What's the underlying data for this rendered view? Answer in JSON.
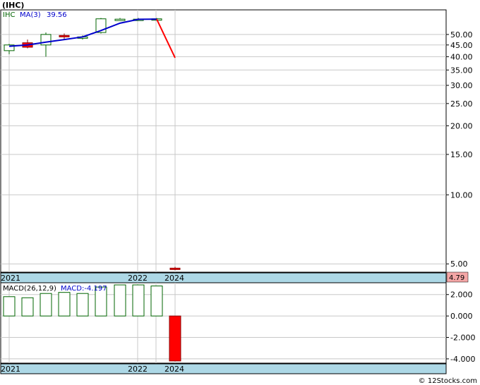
{
  "title": "(IHC)",
  "watermark": "© 12Stocks.com",
  "chart_data": [
    {
      "type": "candlestick",
      "ticker": "IHC",
      "legend": {
        "ticker": "IHC",
        "ma_label": "MA(3)",
        "ma_value": "39.56"
      },
      "y_scale": "log",
      "ylim": [
        4.6,
        64
      ],
      "y_ticks": [
        {
          "value": 50,
          "label": "50.00"
        },
        {
          "value": 45,
          "label": "45.00"
        },
        {
          "value": 40,
          "label": "40.00"
        },
        {
          "value": 35,
          "label": "35.00"
        },
        {
          "value": 30,
          "label": "30.00"
        },
        {
          "value": 25,
          "label": "25.00"
        },
        {
          "value": 20,
          "label": "20.00"
        },
        {
          "value": 15,
          "label": "15.00"
        },
        {
          "value": 10,
          "label": "10.00"
        },
        {
          "value": 5,
          "label": "5.00"
        }
      ],
      "x_labels": [
        "2021",
        "2022",
        "2024"
      ],
      "last_price_badge": "4.79",
      "candles": [
        {
          "open": 42.5,
          "high": 45.5,
          "low": 41.0,
          "close": 45.0
        },
        {
          "open": 46.0,
          "high": 47.5,
          "low": 43.5,
          "close": 44.0
        },
        {
          "open": 45.0,
          "high": 51.0,
          "low": 40.0,
          "close": 50.0
        },
        {
          "open": 49.5,
          "high": 50.5,
          "low": 47.5,
          "close": 49.0
        },
        {
          "open": 48.5,
          "high": 49.5,
          "low": 47.5,
          "close": 48.8
        },
        {
          "open": 51.0,
          "high": 59.0,
          "low": 50.5,
          "close": 58.5
        },
        {
          "open": 58.0,
          "high": 59.0,
          "low": 57.5,
          "close": 58.3
        },
        {
          "open": 58.0,
          "high": 59.0,
          "low": 57.5,
          "close": 58.3
        },
        {
          "open": 58.2,
          "high": 59.0,
          "low": 57.5,
          "close": 58.5
        },
        {
          "open": 4.79,
          "high": 4.85,
          "low": 4.7,
          "close": 4.75
        }
      ],
      "ma": [
        44.4,
        45.0,
        46.3,
        47.5,
        48.8,
        52.0,
        56.0,
        58.2,
        58.3,
        39.56
      ]
    },
    {
      "type": "bar",
      "legend": {
        "label": "MACD(26,12,9)",
        "value_label": "MACD:-4.197"
      },
      "ylim": [
        -4.4,
        3.1
      ],
      "y_ticks": [
        {
          "value": 2,
          "label": "2.000"
        },
        {
          "value": 0,
          "label": "0.000"
        },
        {
          "value": -2,
          "label": "-2.000"
        },
        {
          "value": -4,
          "label": "-4.000"
        }
      ],
      "x_labels": [
        "2021",
        "2022",
        "2024"
      ],
      "values": [
        1.8,
        1.7,
        2.1,
        2.2,
        2.1,
        2.7,
        2.9,
        2.9,
        2.8,
        -4.197
      ]
    }
  ],
  "colors": {
    "up": "#006400",
    "down": "#ff0000",
    "ma_line": "#0000cc",
    "grid": "#c8c8c8",
    "axis_band": "#add8e6",
    "badge": "#f4a6a6",
    "ma_down": "#ff0000"
  }
}
